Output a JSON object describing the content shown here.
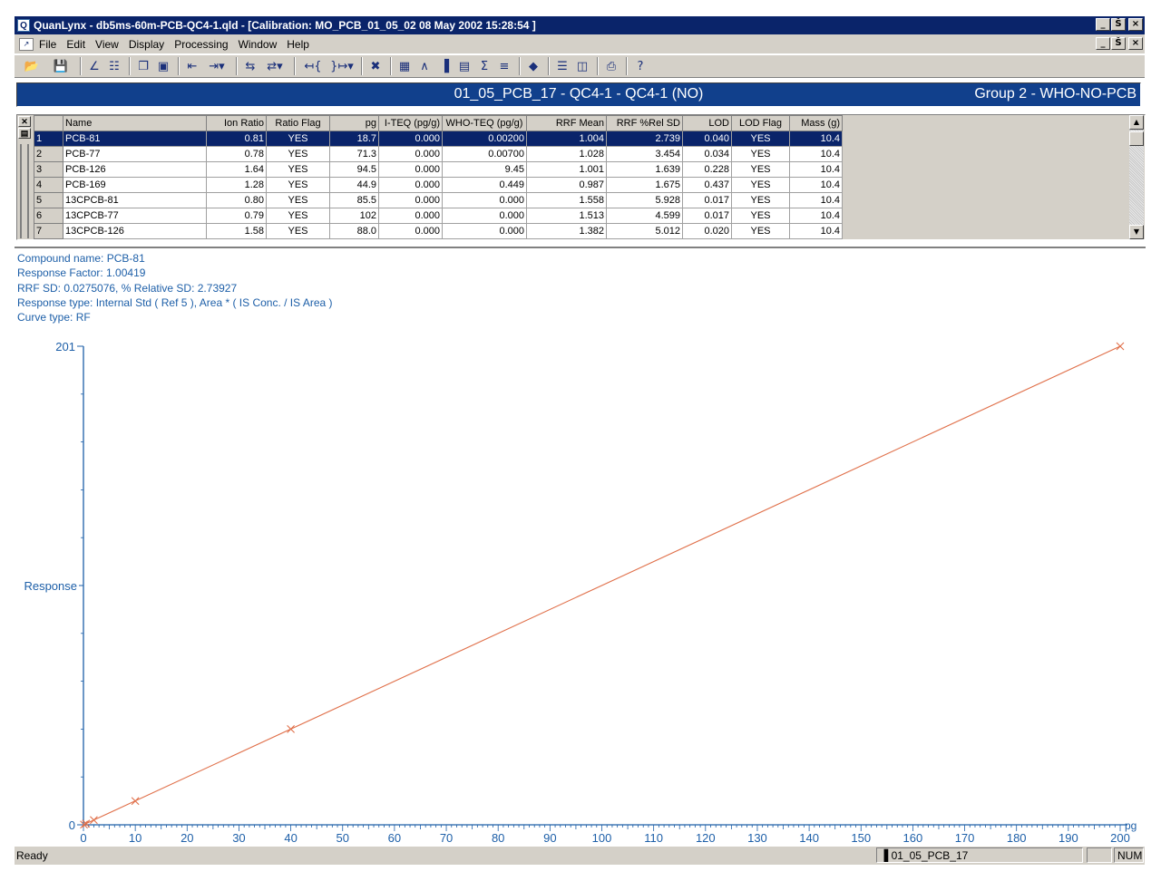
{
  "window": {
    "title": "QuanLynx - db5ms-60m-PCB-QC4-1.qld - [Calibration: MO_PCB_01_05_02 08 May 2002 15:28:54 ]",
    "app_icon": "Q",
    "controls": {
      "minimize": "_",
      "restore": "Š",
      "close": "×"
    }
  },
  "menu": {
    "icon": "chart-icon",
    "items": [
      {
        "label": "File"
      },
      {
        "label": "Edit"
      },
      {
        "label": "View"
      },
      {
        "label": "Display"
      },
      {
        "label": "Processing"
      },
      {
        "label": "Window"
      },
      {
        "label": "Help"
      }
    ]
  },
  "toolbar": {
    "buttons": [
      {
        "icon": "open-folder-icon",
        "glyph": "📂"
      },
      {
        "icon": "save-icon",
        "glyph": "💾"
      },
      {
        "icon": "integrate-icon",
        "glyph": "∠"
      },
      {
        "icon": "peak-list-icon",
        "glyph": "☷"
      },
      {
        "icon": "copy-window-icon",
        "glyph": "❐"
      },
      {
        "icon": "display-icon",
        "glyph": "▣"
      },
      {
        "icon": "prev-sample-icon",
        "glyph": "⇤"
      },
      {
        "icon": "next-sample-icon",
        "glyph": "⇥▾"
      },
      {
        "icon": "prev-compound-icon",
        "glyph": "⇆"
      },
      {
        "icon": "next-compound-icon",
        "glyph": "⇄▾"
      },
      {
        "icon": "prev-group-icon",
        "glyph": "↤{"
      },
      {
        "icon": "next-group-icon",
        "glyph": "}↦▾"
      },
      {
        "icon": "zoom-out-icon",
        "glyph": "✖"
      },
      {
        "icon": "chromatogram-view-icon",
        "glyph": "▦"
      },
      {
        "icon": "peak-view-icon",
        "glyph": "∧"
      },
      {
        "icon": "bar-chart-icon",
        "glyph": "▐"
      },
      {
        "icon": "table-view-icon",
        "glyph": "▤"
      },
      {
        "icon": "sum-icon",
        "glyph": "Σ"
      },
      {
        "icon": "book-icon",
        "glyph": "≡"
      },
      {
        "icon": "layers-icon",
        "glyph": "◆"
      },
      {
        "icon": "split-horizontal-icon",
        "glyph": "☰"
      },
      {
        "icon": "split-vertical-icon",
        "glyph": "◫"
      },
      {
        "icon": "print-icon",
        "glyph": "⎙"
      },
      {
        "icon": "help-icon",
        "glyph": "?"
      }
    ]
  },
  "header_bar": {
    "sample": "01_05_PCB_17 - QC4-1 - QC4-1 (NO)",
    "group": "Group 2 - WHO-NO-PCB"
  },
  "table": {
    "columns": [
      "Name",
      "Ion Ratio",
      "Ratio Flag",
      "pg",
      "I-TEQ (pg/g)",
      "WHO-TEQ (pg/g)",
      "RRF Mean",
      "RRF %Rel SD",
      "LOD",
      "LOD Flag",
      "Mass (g)"
    ],
    "rows": [
      {
        "n": "1",
        "name": "PCB-81",
        "ion": "0.81",
        "rflag": "YES",
        "pg": "18.7",
        "iteq": "0.000",
        "whoteq": "0.00200",
        "rrf": "1.004",
        "rsd": "2.739",
        "lod": "0.040",
        "lflag": "YES",
        "mass": "10.4"
      },
      {
        "n": "2",
        "name": "PCB-77",
        "ion": "0.78",
        "rflag": "YES",
        "pg": "71.3",
        "iteq": "0.000",
        "whoteq": "0.00700",
        "rrf": "1.028",
        "rsd": "3.454",
        "lod": "0.034",
        "lflag": "YES",
        "mass": "10.4"
      },
      {
        "n": "3",
        "name": "PCB-126",
        "ion": "1.64",
        "rflag": "YES",
        "pg": "94.5",
        "iteq": "0.000",
        "whoteq": "9.45",
        "rrf": "1.001",
        "rsd": "1.639",
        "lod": "0.228",
        "lflag": "YES",
        "mass": "10.4"
      },
      {
        "n": "4",
        "name": "PCB-169",
        "ion": "1.28",
        "rflag": "YES",
        "pg": "44.9",
        "iteq": "0.000",
        "whoteq": "0.449",
        "rrf": "0.987",
        "rsd": "1.675",
        "lod": "0.437",
        "lflag": "YES",
        "mass": "10.4"
      },
      {
        "n": "5",
        "name": "13CPCB-81",
        "ion": "0.80",
        "rflag": "YES",
        "pg": "85.5",
        "iteq": "0.000",
        "whoteq": "0.000",
        "rrf": "1.558",
        "rsd": "5.928",
        "lod": "0.017",
        "lflag": "YES",
        "mass": "10.4"
      },
      {
        "n": "6",
        "name": "13CPCB-77",
        "ion": "0.79",
        "rflag": "YES",
        "pg": "102",
        "iteq": "0.000",
        "whoteq": "0.000",
        "rrf": "1.513",
        "rsd": "4.599",
        "lod": "0.017",
        "lflag": "YES",
        "mass": "10.4"
      },
      {
        "n": "7",
        "name": "13CPCB-126",
        "ion": "1.58",
        "rflag": "YES",
        "pg": "88.0",
        "iteq": "0.000",
        "whoteq": "0.000",
        "rrf": "1.382",
        "rsd": "5.012",
        "lod": "0.020",
        "lflag": "YES",
        "mass": "10.4"
      }
    ],
    "selected_row": 0
  },
  "calibration_info": {
    "line1": "Compound name: PCB-81",
    "line2": "Response Factor: 1.00419",
    "line3": "RRF SD: 0.0275076,  % Relative SD: 2.73927",
    "line4": "Response type: Internal Std ( Ref 5 ), Area * ( IS Conc. / IS Area )",
    "line5": "Curve type: RF"
  },
  "chart_data": {
    "type": "scatter",
    "title": "",
    "xlabel": "pg",
    "ylabel": "Response",
    "xlim": [
      0,
      200
    ],
    "ylim": [
      0,
      201
    ],
    "x_ticks": [
      0,
      10,
      20,
      30,
      40,
      50,
      60,
      70,
      80,
      90,
      100,
      110,
      120,
      130,
      140,
      150,
      160,
      170,
      180,
      190,
      200
    ],
    "y_tick_labels": [
      "0",
      "201"
    ],
    "series": [
      {
        "points": [
          [
            0.1,
            0.1
          ],
          [
            0.5,
            0.5
          ],
          [
            2,
            2
          ],
          [
            10,
            10
          ],
          [
            40,
            40.2
          ],
          [
            200,
            201
          ]
        ]
      }
    ],
    "fit_line": [
      [
        0,
        0
      ],
      [
        200,
        201
      ]
    ],
    "color": "#e0704a",
    "axis_color": "#1d5fa8",
    "grid": false
  },
  "statusbar": {
    "ready": "Ready",
    "sample": "01_05_PCB_17",
    "num": "NUM"
  }
}
